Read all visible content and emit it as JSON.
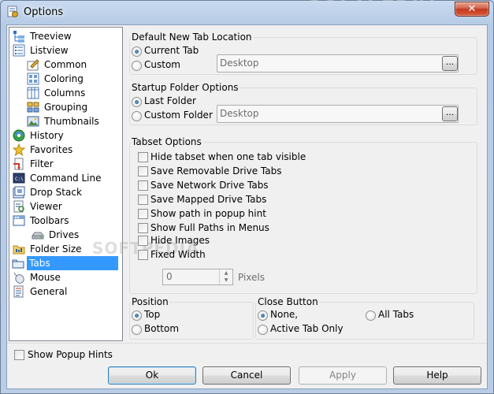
{
  "window": {
    "title": "Options",
    "close_symbol": "✕"
  },
  "watermark": "SOFTPEDIA",
  "tree": {
    "items": [
      {
        "label": "Treeview",
        "icon": "treeview-icon",
        "indent": 0
      },
      {
        "label": "Listview",
        "icon": "listview-icon",
        "indent": 0
      },
      {
        "label": "Common",
        "icon": "common-icon",
        "indent": 1
      },
      {
        "label": "Coloring",
        "icon": "coloring-icon",
        "indent": 1
      },
      {
        "label": "Columns",
        "icon": "columns-icon",
        "indent": 1
      },
      {
        "label": "Grouping",
        "icon": "grouping-icon",
        "indent": 1
      },
      {
        "label": "Thumbnails",
        "icon": "thumbnails-icon",
        "indent": 1
      },
      {
        "label": "History",
        "icon": "history-icon",
        "indent": 0
      },
      {
        "label": "Favorites",
        "icon": "favorites-star-icon",
        "indent": 0
      },
      {
        "label": "Filter",
        "icon": "filter-icon",
        "indent": 0
      },
      {
        "label": "Command Line",
        "icon": "command-line-icon",
        "indent": 0
      },
      {
        "label": "Drop Stack",
        "icon": "drop-stack-icon",
        "indent": 0
      },
      {
        "label": "Viewer",
        "icon": "viewer-icon",
        "indent": 0
      },
      {
        "label": "Toolbars",
        "icon": "toolbars-icon",
        "indent": 0
      },
      {
        "label": "Drives",
        "icon": "drives-icon",
        "indent": 1
      },
      {
        "label": "Folder Size",
        "icon": "folder-size-icon",
        "indent": 0
      },
      {
        "label": "Tabs",
        "icon": "tabs-icon",
        "indent": 0,
        "selected": true
      },
      {
        "label": "Mouse",
        "icon": "mouse-icon",
        "indent": 0
      },
      {
        "label": "General",
        "icon": "general-icon",
        "indent": 0
      }
    ]
  },
  "new_tab_location": {
    "title": "Default New Tab Location",
    "options": [
      {
        "label": "Current Tab",
        "checked": true
      },
      {
        "label": "Custom",
        "checked": false
      }
    ],
    "path_value": "Desktop",
    "browse_label": "..."
  },
  "startup_folder": {
    "title": "Startup Folder Options",
    "options": [
      {
        "label": "Last Folder",
        "checked": true
      },
      {
        "label": "Custom Folder",
        "checked": false
      }
    ],
    "path_value": "Desktop",
    "browse_label": "..."
  },
  "tabset_options": {
    "title": "Tabset Options",
    "checkboxes": [
      {
        "label": "Hide tabset when one tab visible",
        "checked": false
      },
      {
        "label": "Save Removable Drive Tabs",
        "checked": false
      },
      {
        "label": "Save Network Drive Tabs",
        "checked": false
      },
      {
        "label": "Save Mapped Drive Tabs",
        "checked": false
      },
      {
        "label": "Show path in popup hint",
        "checked": false
      },
      {
        "label": "Show Full Paths in Menus",
        "checked": false
      },
      {
        "label": "Hide Images",
        "checked": false
      },
      {
        "label": "Fixed Width",
        "checked": false
      }
    ],
    "width_value": "0",
    "width_unit": "Pixels"
  },
  "position": {
    "title": "Position",
    "options": [
      {
        "label": "Top",
        "checked": true
      },
      {
        "label": "Bottom",
        "checked": false
      }
    ]
  },
  "close_button": {
    "title": "Close Button",
    "options": [
      {
        "label": "None,",
        "checked": true
      },
      {
        "label": "Active Tab Only",
        "checked": false
      },
      {
        "label": "All Tabs",
        "checked": false
      }
    ]
  },
  "footer": {
    "show_popup_hints": {
      "label": "Show Popup Hints",
      "checked": false
    },
    "buttons": {
      "ok": "Ok",
      "cancel": "Cancel",
      "apply": "Apply",
      "help": "Help"
    }
  },
  "colors": {
    "selection": "#3399ff",
    "title_gradient": "#c9daf0",
    "close_red": "#c2381e"
  }
}
